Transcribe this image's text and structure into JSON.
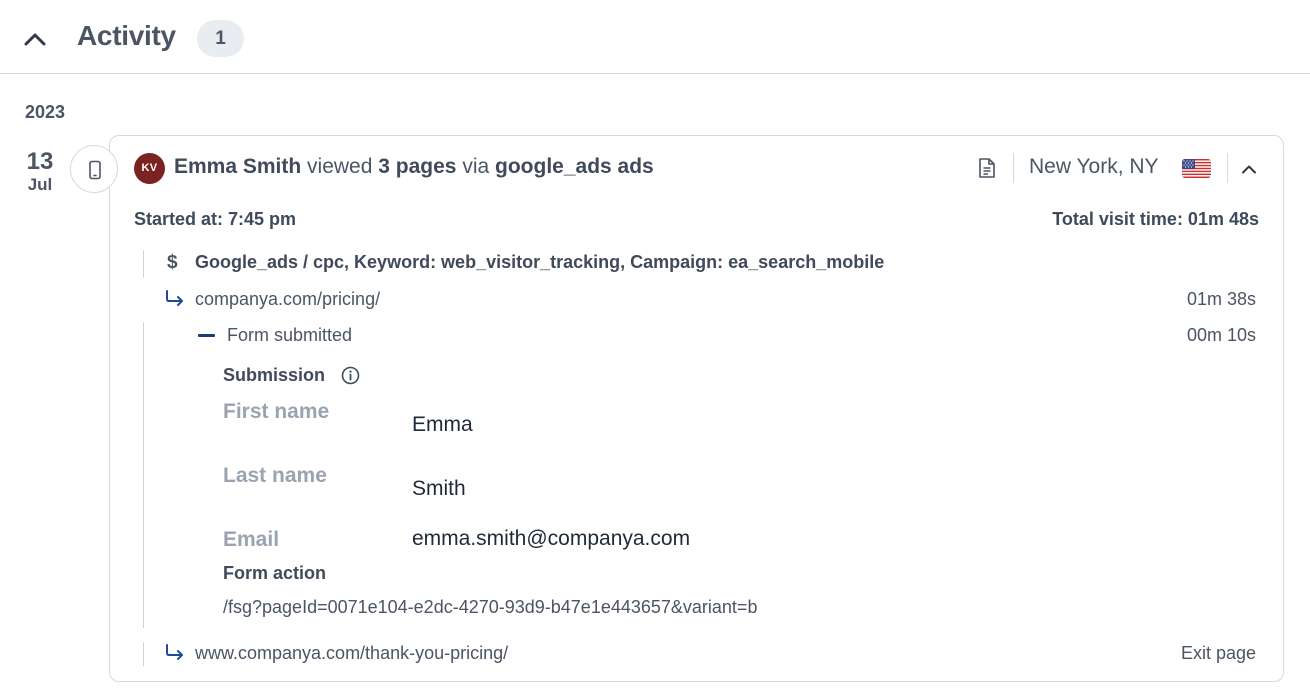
{
  "header": {
    "title": "Activity",
    "count": "1",
    "collapse_icon": "chevron-up-icon"
  },
  "timeline": {
    "year": "2023",
    "day": "13",
    "month": "Jul",
    "device_icon": "mobile-phone-icon"
  },
  "visit": {
    "avatar_initials": "KV",
    "avatar_color": "#7a2320",
    "visitor_name": "Emma Smith",
    "verb": "viewed",
    "pages": "3 pages",
    "via": "via",
    "source_name": "google_ads ads",
    "doc_icon": "document-icon",
    "location": "New York, NY",
    "flag_icon": "us-flag-icon",
    "toggle_icon": "chevron-up-icon",
    "started_at": "Started at: 7:45 pm",
    "total_time": "Total visit time: 01m 48s",
    "source_detail": "Google_ads / cpc, Keyword: web_visitor_tracking, Campaign: ea_search_mobile",
    "events": [
      {
        "url": "companya.com/pricing/",
        "time": "01m 38s",
        "icon": "arrow-turn-right-icon"
      },
      {
        "url": "www.companya.com/thank-you-pricing/",
        "time": "Exit page",
        "icon": "arrow-turn-right-icon"
      }
    ],
    "form": {
      "label": "Form submitted",
      "time": "00m 10s",
      "submission_label": "Submission",
      "fields": [
        {
          "label": "First name",
          "value": "Emma"
        },
        {
          "label": "Last name",
          "value": "Smith"
        },
        {
          "label": "Email",
          "value": "emma.smith@companya.com"
        }
      ],
      "action_label": "Form action",
      "action_value": "/fsg?pageId=0071e104-e2dc-4270-93d9-b47e1e443657&variant=b"
    }
  }
}
